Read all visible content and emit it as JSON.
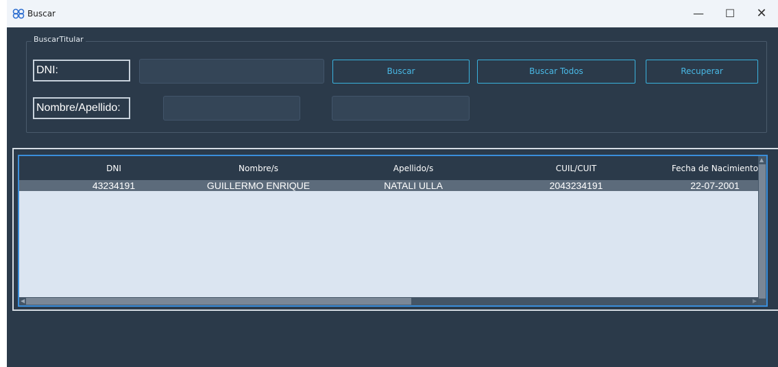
{
  "window": {
    "title": "Buscar",
    "minimize_glyph": "—",
    "maximize_glyph": "☐",
    "close_glyph": "✕",
    "icon": "link-chain-icon"
  },
  "search_group": {
    "title": "BuscarTitular",
    "dni_label": "DNI:",
    "dni_value": "",
    "name_label": "Nombre/Apellido:",
    "name_value": "",
    "surname_value": "",
    "buttons": {
      "search": "Buscar",
      "search_all": "Buscar Todos",
      "recover": "Recuperar"
    }
  },
  "table": {
    "columns": [
      "DNI",
      "Nombre/s",
      "Apellido/s",
      "CUIL/CUIT",
      "Fecha de Nacimiento"
    ],
    "rows": [
      [
        "43234191",
        "GUILLERMO ENRIQUE",
        "NATALI ULLA",
        "2043234191",
        "22-07-2001"
      ]
    ]
  },
  "colors": {
    "background": "#2b3a4a",
    "accent": "#3ab4e0",
    "grid_background": "#dbe5f1",
    "selection": "#3a8fdc"
  }
}
